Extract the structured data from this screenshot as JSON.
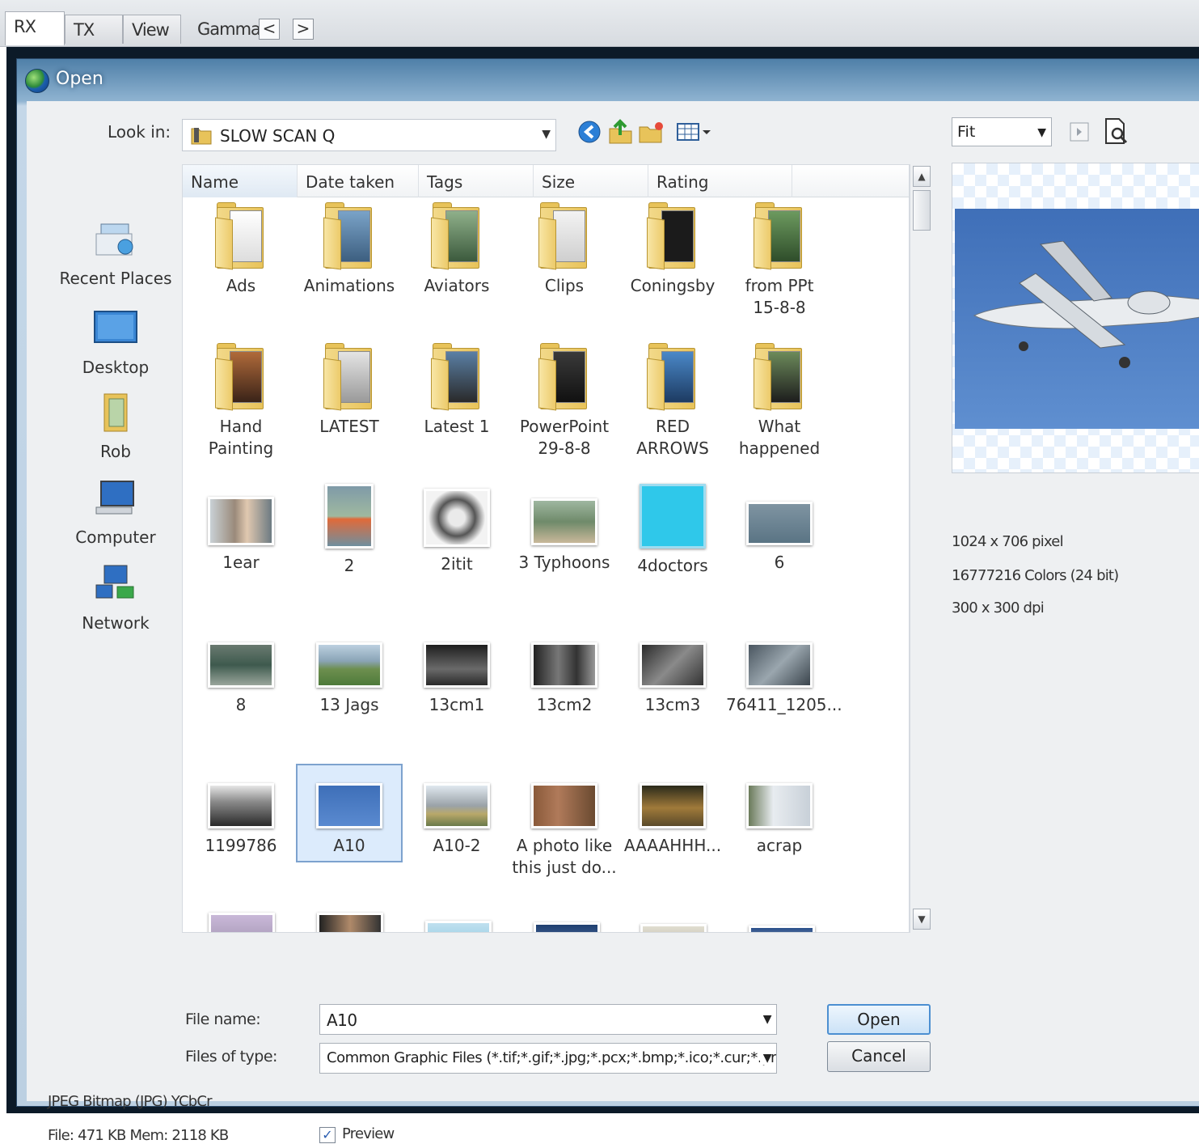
{
  "app_tabs": [
    {
      "label": "RX"
    },
    {
      "label": "TX"
    },
    {
      "label": "View"
    },
    {
      "label": "Gamma"
    }
  ],
  "nav": {
    "prev": "<",
    "next": ">"
  },
  "dialog": {
    "title": "Open",
    "look_in_label": "Look in:",
    "look_in_value": "SLOW SCAN Q",
    "places": [
      {
        "label": "Recent Places",
        "icon": "recent-places-icon"
      },
      {
        "label": "Desktop",
        "icon": "desktop-icon"
      },
      {
        "label": "Rob",
        "icon": "user-folder-icon"
      },
      {
        "label": "Computer",
        "icon": "computer-icon"
      },
      {
        "label": "Network",
        "icon": "network-icon"
      }
    ],
    "columns": [
      "Name",
      "Date taken",
      "Tags",
      "Size",
      "Rating"
    ],
    "folders": [
      {
        "name": "Ads"
      },
      {
        "name": "Animations"
      },
      {
        "name": "Aviators"
      },
      {
        "name": "Clips"
      },
      {
        "name": "Coningsby"
      },
      {
        "name": "from PPt\n15-8-8"
      },
      {
        "name": "Hand\nPainting"
      },
      {
        "name": "LATEST"
      },
      {
        "name": "Latest 1"
      },
      {
        "name": "PowerPoint\n29-8-8"
      },
      {
        "name": "RED\nARROWS"
      },
      {
        "name": "What\nhappened"
      }
    ],
    "files": [
      {
        "name": "1ear"
      },
      {
        "name": "2"
      },
      {
        "name": "2itit"
      },
      {
        "name": "3 Typhoons"
      },
      {
        "name": "4doctors"
      },
      {
        "name": "6"
      },
      {
        "name": "8"
      },
      {
        "name": "13 Jags"
      },
      {
        "name": "13cm1"
      },
      {
        "name": "13cm2"
      },
      {
        "name": "13cm3"
      },
      {
        "name": "76411_1205..."
      },
      {
        "name": "1199786"
      },
      {
        "name": "A10"
      },
      {
        "name": "A10-2"
      },
      {
        "name": "A photo like\nthis just do..."
      },
      {
        "name": "AAAAHHH..."
      },
      {
        "name": "acrap"
      }
    ],
    "selected_file": "A10",
    "file_name_label": "File name:",
    "file_name_value": "A10",
    "files_of_type_label": "Files of type:",
    "files_of_type_value": "Common Graphic Files (*.tif;*.gif;*.jpg;*.pcx;*.bmp;*.ico;*.cur;*.pr",
    "open_button": "Open",
    "cancel_button": "Cancel",
    "preview_fit": "Fit",
    "image_info": {
      "dimensions": "1024 x 706 pixel",
      "colors": "16777216 Colors (24 bit)",
      "dpi": "300 x 300 dpi"
    },
    "status_format": "JPEG Bitmap (JPG) YCbCr",
    "status_size": "File: 471 KB   Mem: 2118 KB",
    "preview_checkbox_label": "Preview",
    "preview_checked": true
  }
}
